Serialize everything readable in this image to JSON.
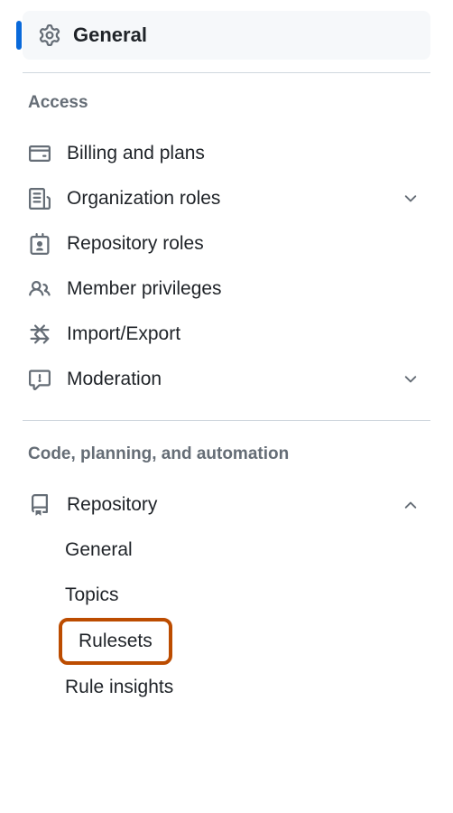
{
  "general": {
    "label": "General"
  },
  "sections": {
    "access": {
      "heading": "Access",
      "items": {
        "billing": {
          "label": "Billing and plans"
        },
        "orgRoles": {
          "label": "Organization roles"
        },
        "repoRoles": {
          "label": "Repository roles"
        },
        "memberPriv": {
          "label": "Member privileges"
        },
        "importExport": {
          "label": "Import/Export"
        },
        "moderation": {
          "label": "Moderation"
        }
      }
    },
    "code": {
      "heading": "Code, planning, and automation",
      "repository": {
        "label": "Repository",
        "sub": {
          "general": "General",
          "topics": "Topics",
          "rulesets": "Rulesets",
          "ruleInsights": "Rule insights"
        }
      }
    }
  }
}
